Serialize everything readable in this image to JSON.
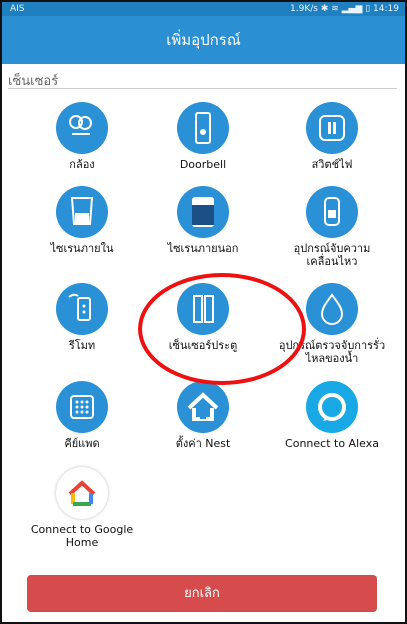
{
  "status": {
    "carrier": "AIS",
    "right_text": "1.9K/s ✱ ≋ ▂▄▆ ▯ 14:19"
  },
  "appbar": {
    "title": "เพิ่มอุปกรณ์"
  },
  "section": {
    "title": "เซ็นเซอร์"
  },
  "tiles": [
    {
      "label": "กล้อง",
      "icon": "camera-icon"
    },
    {
      "label": "Doorbell",
      "icon": "doorbell-icon"
    },
    {
      "label": "สวิตช์ไฟ",
      "icon": "switch-icon"
    },
    {
      "label": "ไซเรนภายใน",
      "icon": "siren-indoor-icon"
    },
    {
      "label": "ไซเรนภายนอก",
      "icon": "siren-outdoor-icon"
    },
    {
      "label": "อุปกรณ์จับความเคลื่อนไหว",
      "icon": "motion-sensor-icon"
    },
    {
      "label": "รีโมท",
      "icon": "remote-icon"
    },
    {
      "label": "เซ็นเซอร์ประตู",
      "icon": "door-sensor-icon"
    },
    {
      "label": "อุปกรณ์ตรวจจับการรั่วไหลของน้ำ",
      "icon": "water-leak-icon"
    },
    {
      "label": "คีย์แพด",
      "icon": "keypad-icon"
    },
    {
      "label": "ตั้งค่า Nest",
      "icon": "nest-home-icon"
    },
    {
      "label": "Connect to Alexa",
      "icon": "alexa-icon"
    },
    {
      "label": "Connect to Google Home",
      "icon": "google-home-icon"
    }
  ],
  "cancel_button": {
    "label": "ยกเลิก"
  },
  "colors": {
    "primary": "#2a91d6",
    "cancel": "#d64b4b",
    "highlight": "#ee1111"
  }
}
